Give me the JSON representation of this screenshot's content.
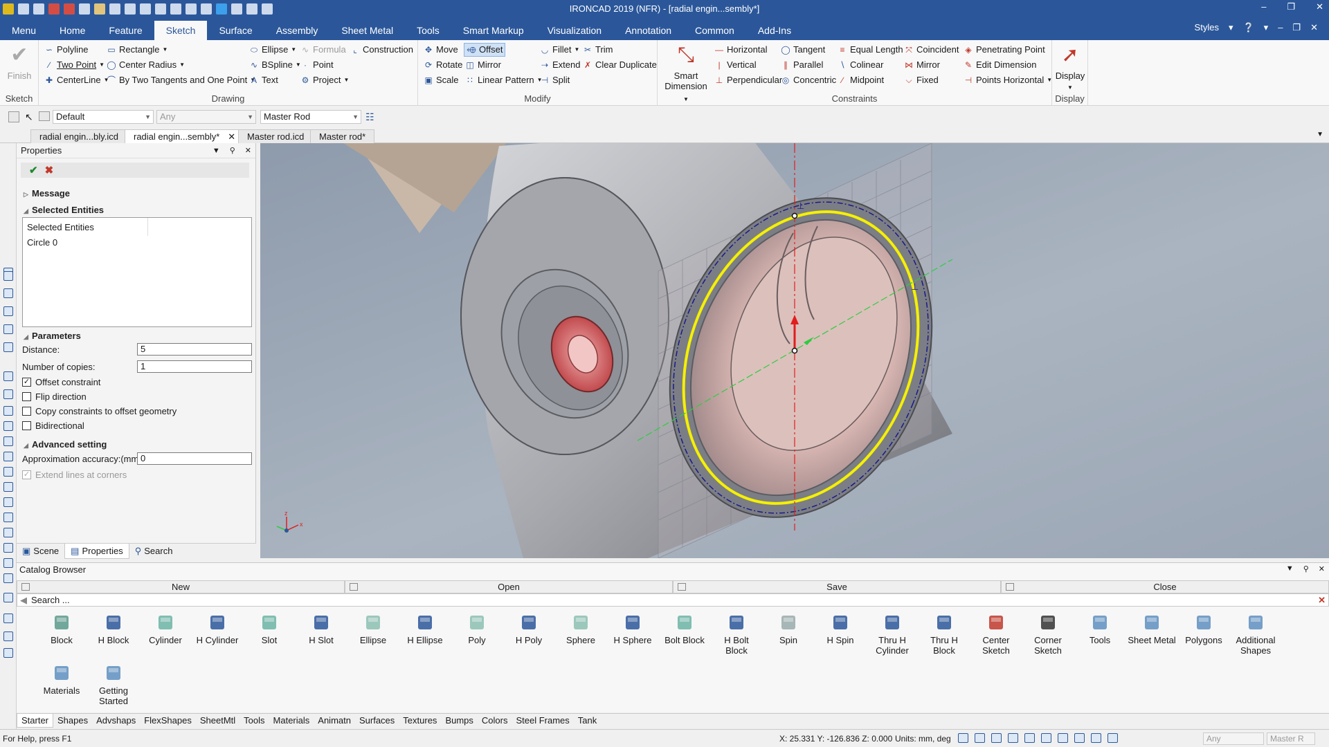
{
  "window": {
    "title": "IRONCAD 2019 (NFR) - [radial engin...sembly*]"
  },
  "colors": {
    "brand": "#2b579a",
    "highlight_circle": "#f5f000",
    "axis_red": "#e11d1d",
    "axis_green": "#2ecc40"
  },
  "ribbon_tabs": [
    "Menu",
    "Home",
    "Feature",
    "Sketch",
    "Surface",
    "Assembly",
    "Sheet Metal",
    "Tools",
    "Smart Markup",
    "Visualization",
    "Annotation",
    "Common",
    "Add-Ins"
  ],
  "active_ribbon_tab": "Sketch",
  "ribbon_right": {
    "styles": "Styles"
  },
  "groups": {
    "sketch": {
      "label": "Sketch",
      "finish": "Finish"
    },
    "drawing": {
      "label": "Drawing",
      "polyline": "Polyline",
      "rectangle": "Rectangle",
      "ellipse": "Ellipse",
      "formula": "Formula",
      "construction": "Construction",
      "two_point": "Two Point",
      "center_radius": "Center Radius",
      "bspline": "BSpline",
      "point": "Point",
      "centerline": "CenterLine",
      "by_two_tangents": "By Two Tangents and One Point",
      "text": "Text",
      "project": "Project"
    },
    "modify": {
      "label": "Modify",
      "move": "Move",
      "offset": "Offset",
      "fillet": "Fillet",
      "trim": "Trim",
      "rotate": "Rotate",
      "mirror": "Mirror",
      "extend": "Extend",
      "clear_duplicate": "Clear Duplicate",
      "scale": "Scale",
      "linear_pattern": "Linear Pattern",
      "split": "Split"
    },
    "constraints": {
      "label": "Constraints",
      "smart_dimension_1": "Smart",
      "smart_dimension_2": "Dimension",
      "horizontal": "Horizontal",
      "tangent": "Tangent",
      "equal_length": "Equal Length",
      "coincident": "Coincident",
      "penetrating_point": "Penetrating Point",
      "vertical": "Vertical",
      "parallel": "Parallel",
      "colinear": "Colinear",
      "mirror": "Mirror",
      "edit_dimension": "Edit Dimension",
      "perpendicular": "Perpendicular",
      "concentric": "Concentric",
      "midpoint": "Midpoint",
      "fixed": "Fixed",
      "points_horizontal": "Points Horizontal"
    },
    "display": {
      "label": "Display",
      "display": "Display"
    }
  },
  "toolbar2": {
    "style_combo": "Default",
    "filter_combo": "Any",
    "part_combo": "Master Rod"
  },
  "doc_tabs": [
    "radial engin...bly.icd",
    "radial engin...sembly*",
    "Master rod.icd",
    "Master rod*"
  ],
  "active_doc_tab": 1,
  "properties": {
    "title": "Properties",
    "message": "Message",
    "selected_entities_header": "Selected Entities",
    "selected_entities_col": "Selected Entities",
    "selected_item": "Circle 0",
    "parameters": "Parameters",
    "distance_label": "Distance:",
    "distance_value": "5",
    "copies_label": "Number of copies:",
    "copies_value": "1",
    "offset_constraint": "Offset constraint",
    "flip_direction": "Flip direction",
    "copy_constraints": "Copy constraints to offset geometry",
    "bidirectional": "Bidirectional",
    "advanced": "Advanced setting",
    "accuracy_label": "Approximation accuracy:(mm)",
    "accuracy_value": "0",
    "extend_lines": "Extend lines at corners",
    "footer": [
      "Scene",
      "Properties",
      "Search"
    ]
  },
  "viewport": {
    "axis_z": "z",
    "axis_x": "x"
  },
  "catalog": {
    "title": "Catalog Browser",
    "buttons": [
      "New",
      "Open",
      "Save",
      "Close"
    ],
    "search_placeholder": "Search ...",
    "items": [
      "Block",
      "H Block",
      "Cylinder",
      "H Cylinder",
      "Slot",
      "H Slot",
      "Ellipse",
      "H Ellipse",
      "Poly",
      "H Poly",
      "Sphere",
      "H Sphere",
      "Bolt Block",
      "H Bolt Block",
      "Spin",
      "H Spin",
      "Thru H Cylinder",
      "Thru H Block",
      "Center Sketch",
      "Corner Sketch",
      "Tools",
      "Sheet Metal",
      "Polygons",
      "Additional Shapes",
      "Materials",
      "Getting Started"
    ],
    "tabs": [
      "Starter",
      "Shapes",
      "Advshaps",
      "FlexShapes",
      "SheetMtl",
      "Tools",
      "Materials",
      "Animatn",
      "Surfaces",
      "Textures",
      "Bumps",
      "Colors",
      "Steel Frames",
      "Tank"
    ]
  },
  "status": {
    "help": "For Help, press F1",
    "coords": "X: 25.331 Y: -126.836 Z: 0.000",
    "units": "Units: mm, deg",
    "combo1": "Any",
    "combo2": "Master R"
  }
}
